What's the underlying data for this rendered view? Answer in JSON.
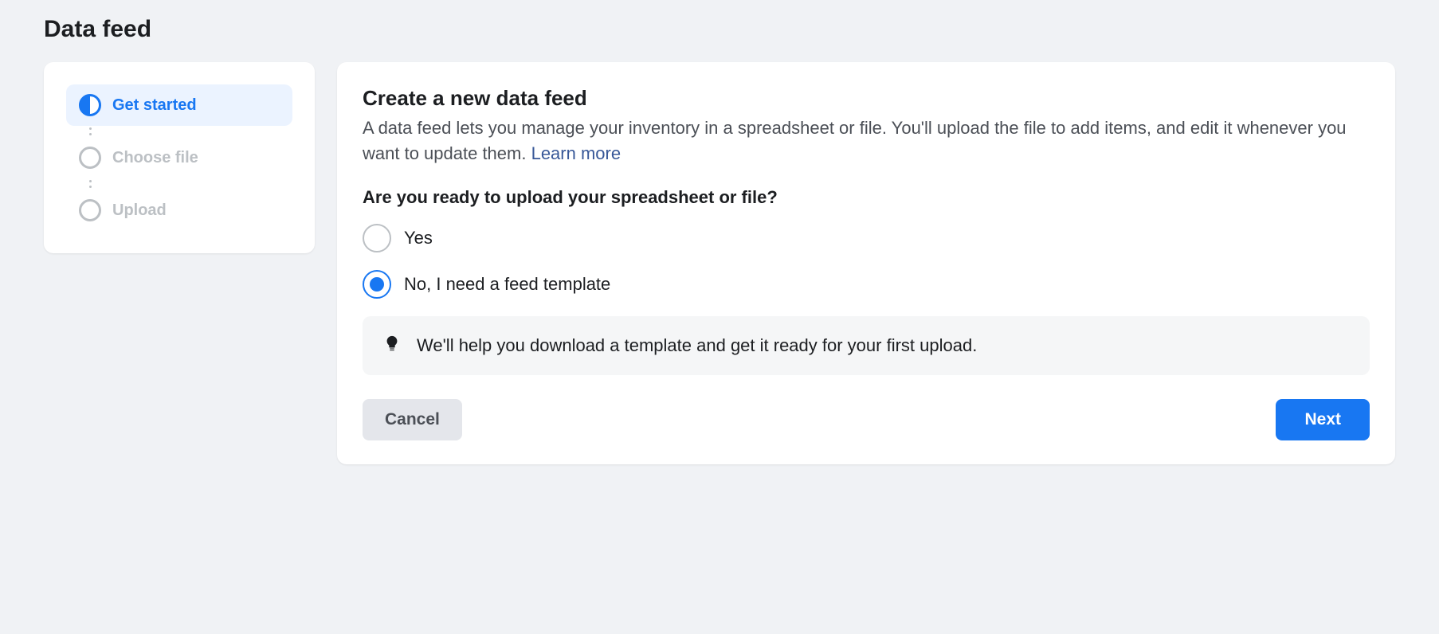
{
  "page": {
    "title": "Data feed"
  },
  "sidebar": {
    "steps": [
      {
        "label": "Get started",
        "active": true
      },
      {
        "label": "Choose file",
        "active": false
      },
      {
        "label": "Upload",
        "active": false
      }
    ]
  },
  "main": {
    "heading": "Create a new data feed",
    "description_prefix": "A data feed lets you manage your inventory in a spreadsheet or file. You'll upload the file to add items, and edit it whenever you want to update them. ",
    "learn_more": "Learn more",
    "question": "Are you ready to upload your spreadsheet or file?",
    "options": [
      {
        "label": "Yes",
        "selected": false
      },
      {
        "label": "No, I need a feed template",
        "selected": true
      }
    ],
    "info_text": "We'll help you download a template and get it ready for your first upload.",
    "cancel_label": "Cancel",
    "next_label": "Next"
  }
}
